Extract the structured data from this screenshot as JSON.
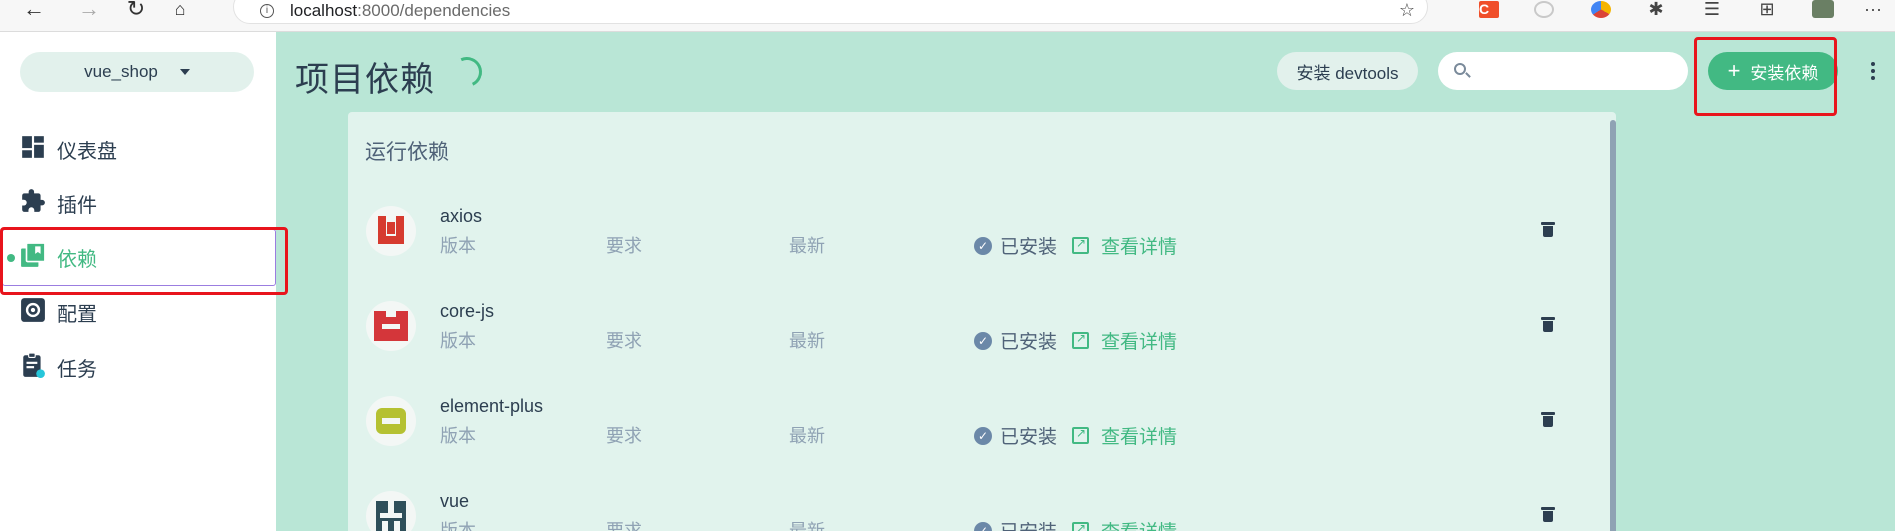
{
  "browser": {
    "url_host": "localhost",
    "url_rest": ":8000/dependencies",
    "ext_c_label": "C"
  },
  "sidebar": {
    "project": "vue_shop",
    "items": [
      {
        "label": "仪表盘",
        "icon": "dashboard-icon"
      },
      {
        "label": "插件",
        "icon": "puzzle-icon"
      },
      {
        "label": "依赖",
        "icon": "library-icon",
        "active": true
      },
      {
        "label": "配置",
        "icon": "settings-icon"
      },
      {
        "label": "任务",
        "icon": "tasks-icon"
      }
    ]
  },
  "header": {
    "title": "项目依赖",
    "devtools_label": "安装 devtools",
    "search_placeholder": "",
    "install_label": "安装依赖",
    "install_plus": "+"
  },
  "panel": {
    "title": "运行依赖",
    "columns": {
      "version": "版本",
      "required": "要求",
      "latest": "最新"
    },
    "status_installed": "已安装",
    "details_label": "查看详情",
    "deps": [
      {
        "name": "axios",
        "logo_color": "#d63a2f"
      },
      {
        "name": "core-js",
        "logo_color": "#d4363a"
      },
      {
        "name": "element-plus",
        "logo_color": "#b5c132"
      },
      {
        "name": "vue",
        "logo_color": "#2f4f5a"
      }
    ]
  },
  "colors": {
    "accent": "#42b983",
    "main_bg": "#b9e6d6",
    "panel_bg": "#e1f3ed",
    "highlight_border": "#e8141c"
  }
}
